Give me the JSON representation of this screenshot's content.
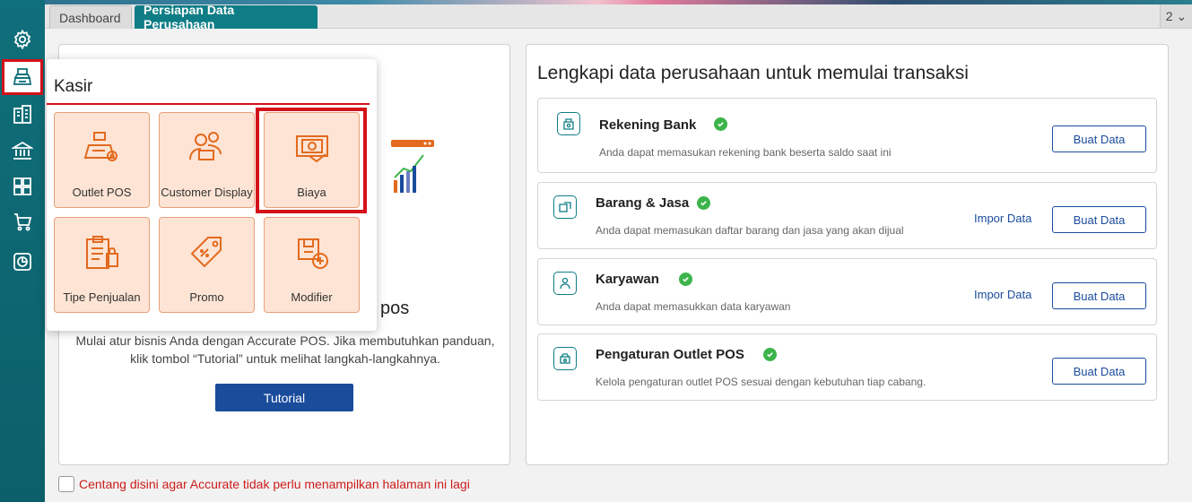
{
  "tabs": {
    "dashboard": "Dashboard",
    "persiapan": "Persiapan Data Perusahaan",
    "counter": "2 ⌄"
  },
  "sidebar": {
    "items": [
      "settings-icon",
      "cashier-icon",
      "building-icon",
      "bank-icon",
      "inventory-icon",
      "cart-icon",
      "report-icon"
    ]
  },
  "left_panel": {
    "title_tail": "pos",
    "description_line1": "Mulai atur bisnis Anda dengan Accurate POS. Jika membutuhkan panduan,",
    "description_line2": "klik tombol “Tutorial” untuk melihat langkah-langkahnya.",
    "tutorial_label": "Tutorial"
  },
  "right_panel": {
    "title": "Lengkapi data perusahaan untuk memulai transaksi",
    "cards": [
      {
        "title": "Rekening Bank",
        "desc": "Anda dapat memasukan rekening bank beserta saldo saat ini",
        "impor": "",
        "button": "Buat Data"
      },
      {
        "title": "Barang & Jasa",
        "desc": "Anda dapat memasukan daftar barang dan jasa yang akan dijual",
        "impor": "Impor Data",
        "button": "Buat Data"
      },
      {
        "title": "Karyawan",
        "desc": "Anda dapat memasukkan data karyawan",
        "impor": "Impor Data",
        "button": "Buat Data"
      },
      {
        "title": "Pengaturan Outlet POS",
        "desc": "Kelola pengaturan outlet POS sesuai dengan kebutuhan tiap cabang.",
        "impor": "",
        "button": "Buat Data"
      }
    ]
  },
  "footer": {
    "checkbox_label": "Centang disini agar Accurate tidak perlu menampilkan halaman ini lagi"
  },
  "popup": {
    "title": "Kasir",
    "tiles": [
      {
        "label": "Outlet POS",
        "icon": "pos-register-icon"
      },
      {
        "label": "Customer Display",
        "icon": "customer-display-icon"
      },
      {
        "label": "Biaya",
        "icon": "money-expense-icon"
      },
      {
        "label": "Tipe Penjualan",
        "icon": "clipboard-bag-icon"
      },
      {
        "label": "Promo",
        "icon": "tag-icon"
      },
      {
        "label": "Modifier",
        "icon": "box-plus-icon"
      }
    ]
  },
  "colors": {
    "sidebar": "#0f6f7a",
    "tab_active": "#0f7d86",
    "accent_blue": "#1a4c9c",
    "highlight_red": "#d4121a",
    "check_green": "#3cb44b",
    "tile_bg": "#fde4d4",
    "icon_orange": "#e36a1e"
  }
}
